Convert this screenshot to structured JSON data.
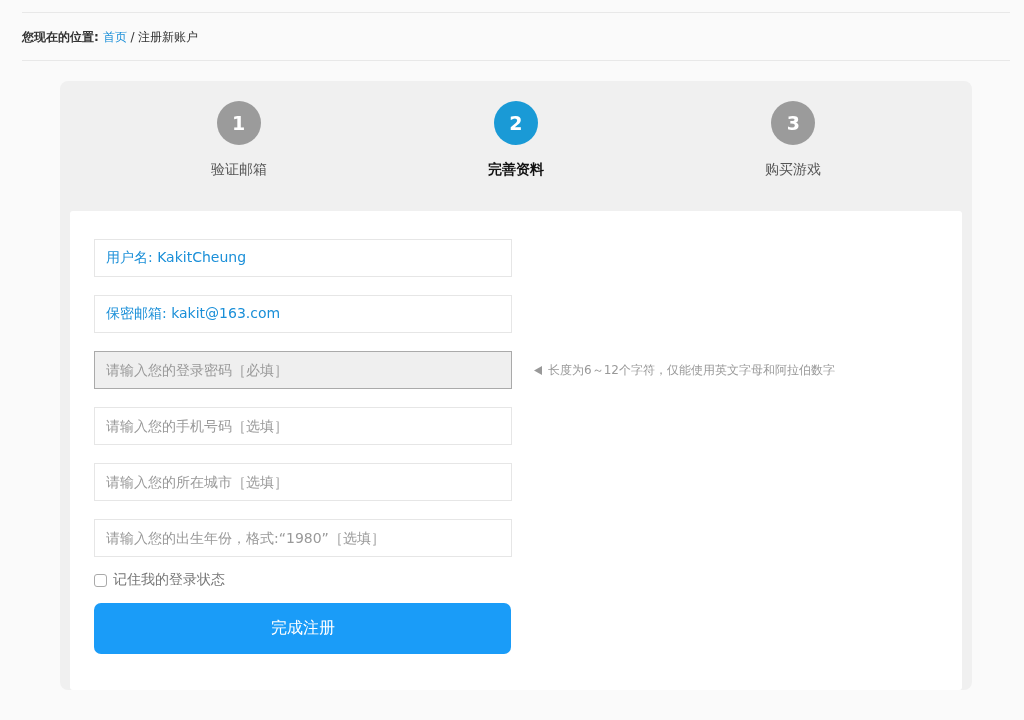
{
  "breadcrumb": {
    "label": "您现在的位置:",
    "link": "首页",
    "separator": "/",
    "current": "注册新账户"
  },
  "steps": [
    {
      "number": "1",
      "label": "验证邮箱",
      "selected": false
    },
    {
      "number": "2",
      "label": "完善资料",
      "selected": true
    },
    {
      "number": "3",
      "label": "购买游戏",
      "selected": false
    }
  ],
  "fields": [
    {
      "value": "用户名: KakitCheung",
      "focused": false
    },
    {
      "value": "保密邮箱: kakit@163.com",
      "focused": false
    },
    {
      "placeholder": "请输入您的登录密码［必填］",
      "focused": true,
      "hint": "长度为6～12个字符，仅能使用英文字母和阿拉伯数字"
    },
    {
      "placeholder": "请输入您的手机号码［选填］",
      "focused": false
    },
    {
      "placeholder": "请输入您的所在城市［选填］",
      "focused": false
    },
    {
      "placeholder": "请输入您的出生年份，格式:“1980”［选填］",
      "focused": false
    }
  ],
  "remember": {
    "label": "记住我的登录状态",
    "checked": false
  },
  "submit": {
    "label": "完成注册"
  }
}
